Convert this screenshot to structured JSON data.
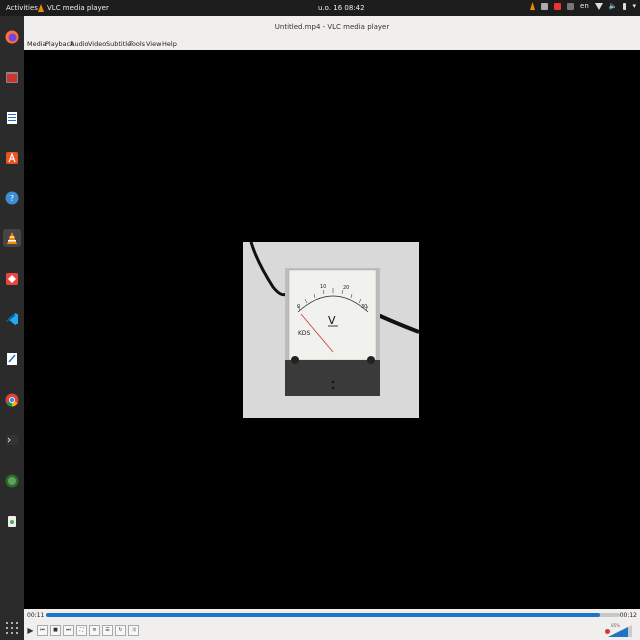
{
  "topbar": {
    "activities": "Activities",
    "app_name": "VLC media player",
    "clock": "u.o. 16  08:42",
    "lang": "en"
  },
  "window": {
    "title": "Untitled.mp4 - VLC media player"
  },
  "menu": [
    "Media",
    "Playback",
    "Audio",
    "Video",
    "Subtitle",
    "Tools",
    "View",
    "Help"
  ],
  "controls": {
    "elapsed": "00:11",
    "total": "00:12",
    "progress": 0.965,
    "volume": "85%"
  },
  "meter": {
    "brand": "KDS",
    "unit": "V",
    "scale": [
      "0",
      "10",
      "20",
      "30"
    ]
  },
  "dock": {
    "apps": [
      "firefox-icon",
      "files-icon",
      "writer-icon",
      "app-center-icon",
      "help-icon",
      "vlc-icon",
      "anydesk-icon",
      "vscode-icon",
      "text-editor-icon",
      "chrome-icon",
      "terminal-icon",
      "globe-icon",
      "trash-icon"
    ]
  },
  "colors": {
    "seek_fill": "#1e74c9",
    "vlc_orange": "#f38b00"
  }
}
